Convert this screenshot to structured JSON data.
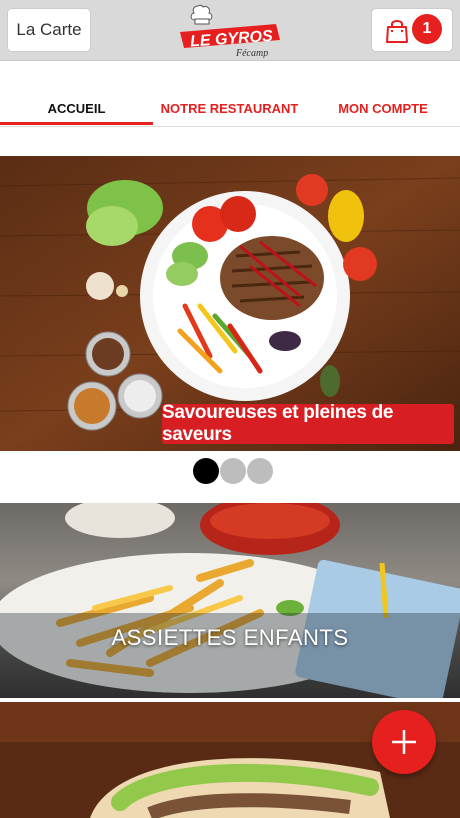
{
  "header": {
    "menu_label": "La Carte",
    "logo_text": "LE GYROS",
    "logo_subtext": "Fécamp",
    "cart_count": "1"
  },
  "tabs": [
    {
      "label": "ACCUEIL",
      "active": true
    },
    {
      "label": "NOTRE RESTAURANT",
      "active": false
    },
    {
      "label": "MON COMPTE",
      "active": false
    }
  ],
  "hero": {
    "slogan": "Savoureuses et pleines de saveurs",
    "slide_count": 3,
    "active_slide": 1
  },
  "categories": [
    {
      "title": "ASSIETTES ENFANTS"
    }
  ],
  "colors": {
    "brand_red": "#e5201e",
    "header_bg": "#d9d9d9"
  },
  "icons": {
    "cart": "shopping-bag-icon",
    "fab": "plus-icon"
  }
}
